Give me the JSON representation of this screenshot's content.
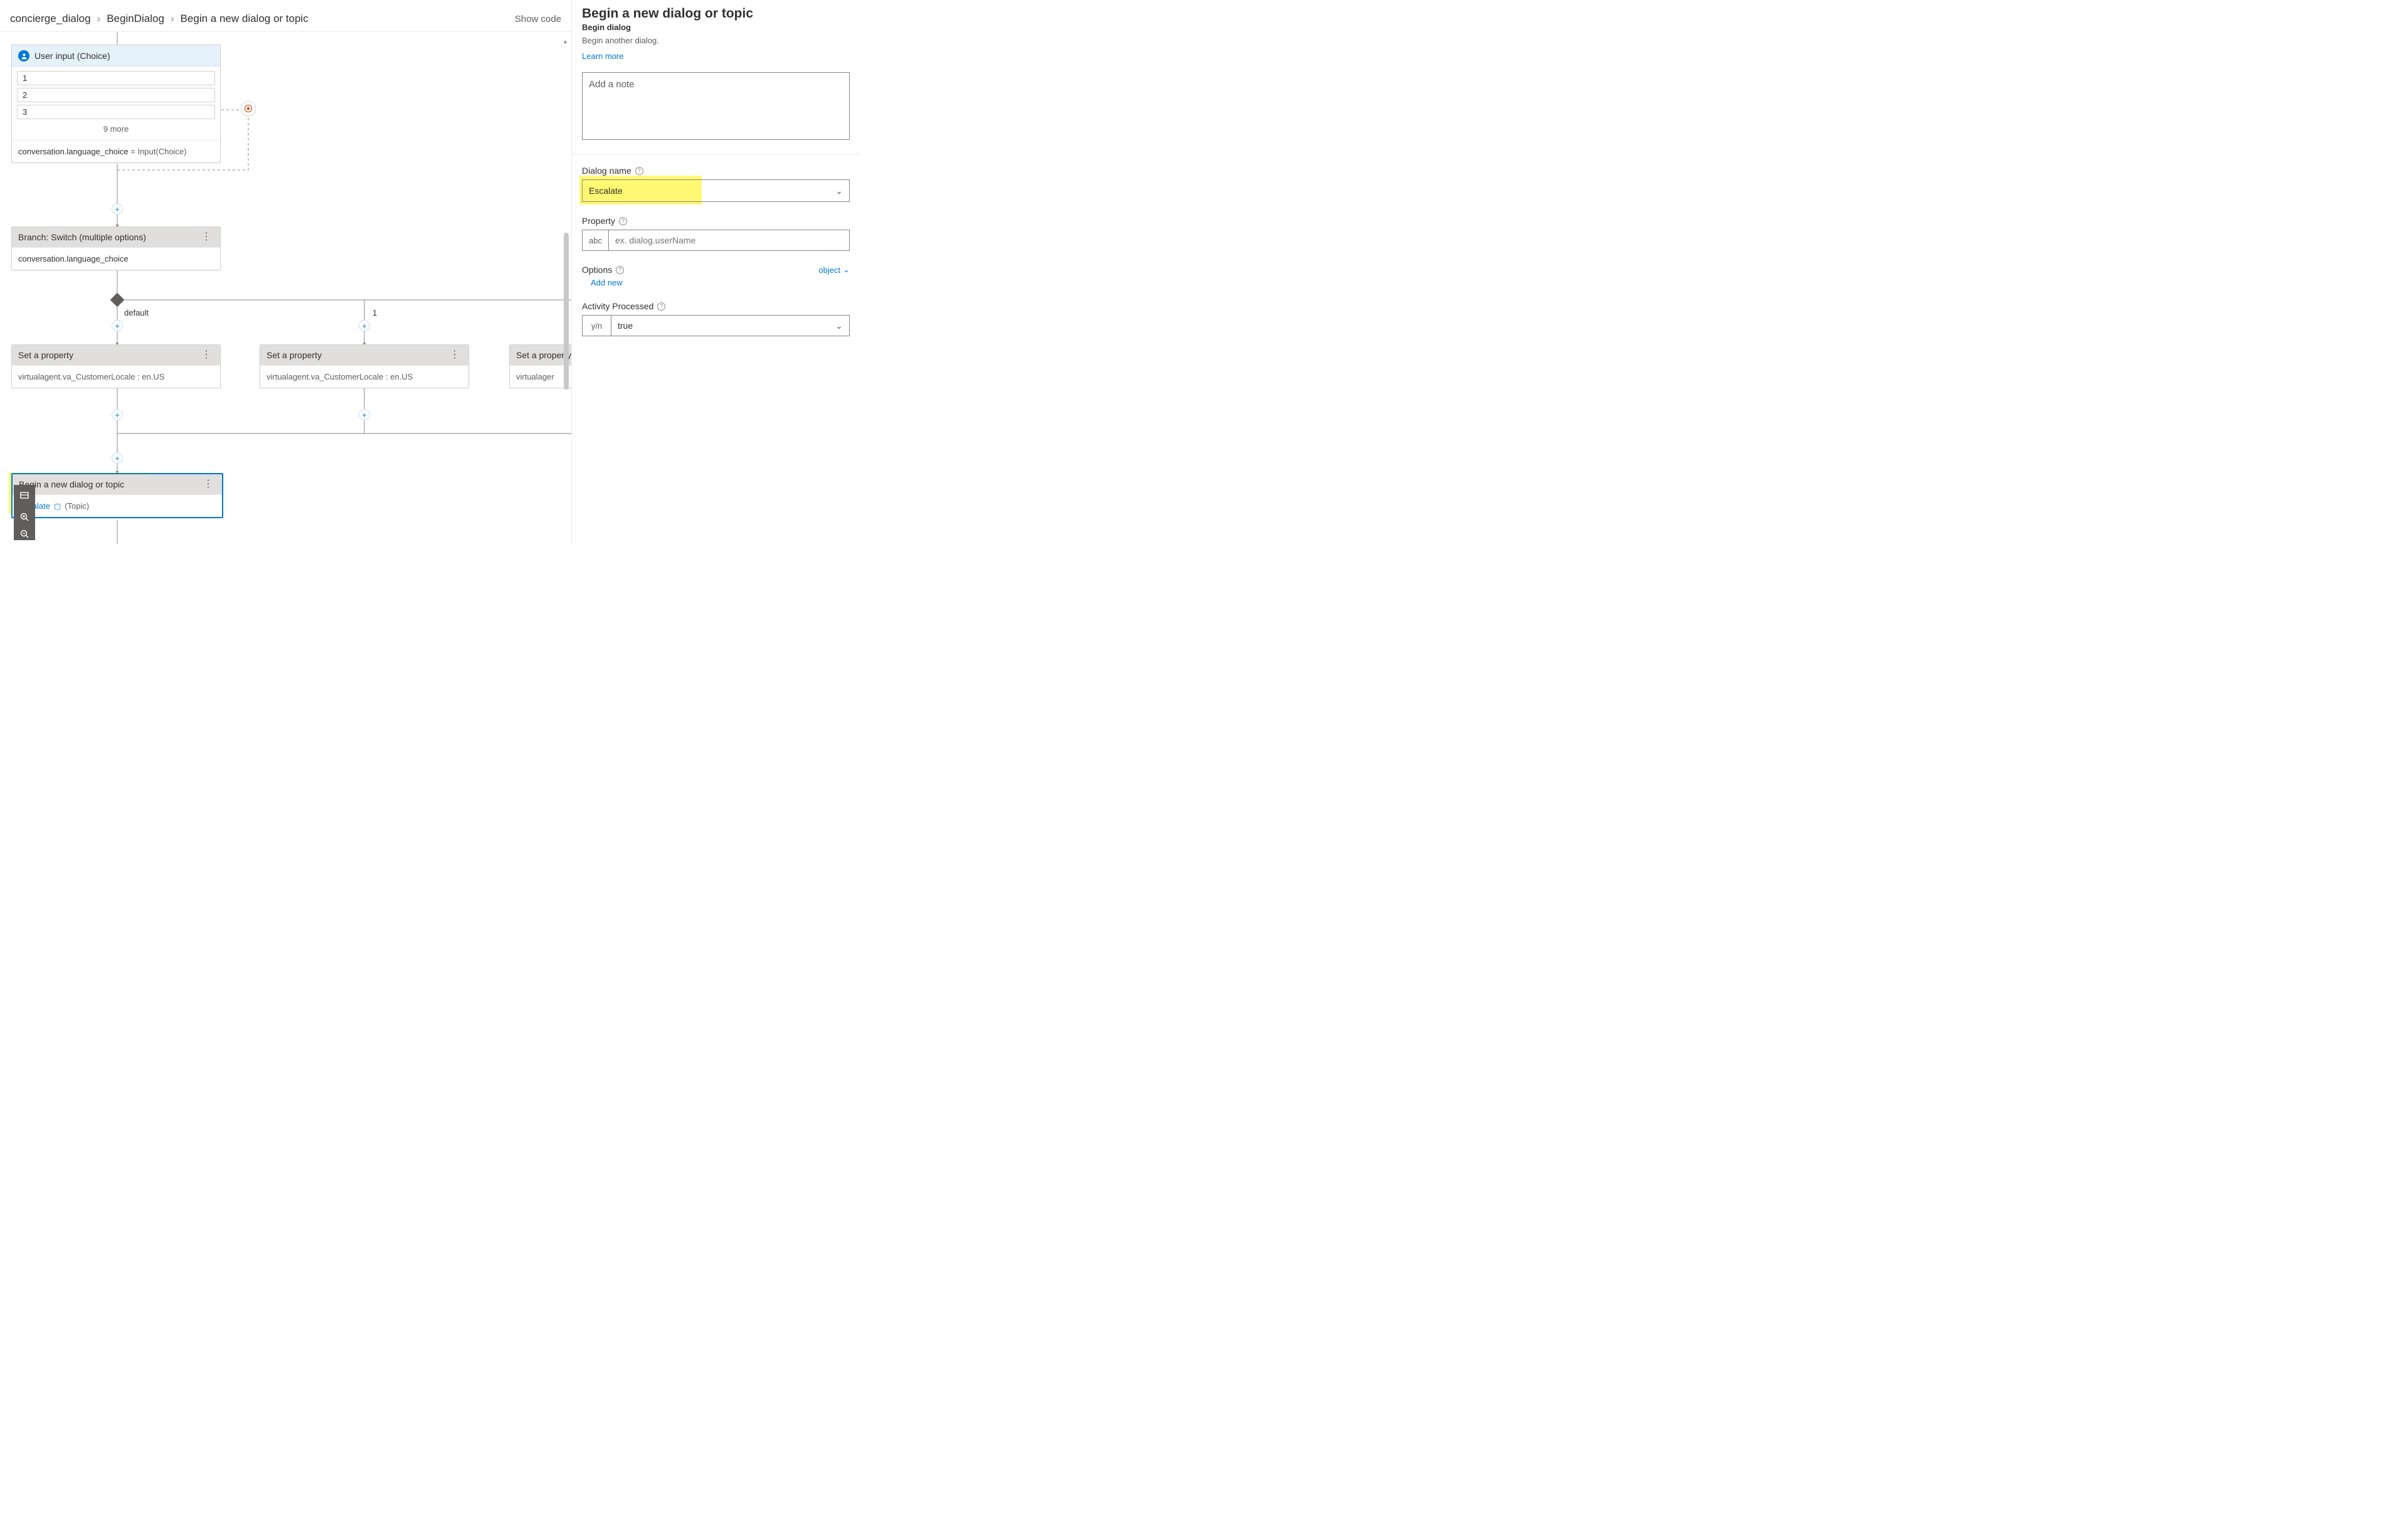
{
  "breadcrumb": {
    "items": [
      "concierge_dialog",
      "BeginDialog",
      "Begin a new dialog or topic"
    ],
    "show_code": "Show code"
  },
  "canvas": {
    "user_input": {
      "title": "User input (Choice)",
      "items": [
        "1",
        "2",
        "3"
      ],
      "more": "9 more",
      "footer_var": "conversation.language_choice",
      "footer_eq": " = Input(Choice)"
    },
    "switch": {
      "title": "Branch: Switch (multiple options)",
      "expression": "conversation.language_choice"
    },
    "branches": {
      "default_label": "default",
      "one_label": "1"
    },
    "setprop": {
      "title": "Set a property",
      "body_a": "virtualagent.va_CustomerLocale : en.US",
      "body_b": "virtualagent.va_CustomerLocale : en.US",
      "body_c": "virtualager"
    },
    "begindialog": {
      "title": "Begin a new dialog or topic",
      "link": "Escalate",
      "suffix": "(Topic)"
    }
  },
  "panel": {
    "title": "Begin a new dialog or topic",
    "subtitle": "Begin dialog",
    "description": "Begin another dialog.",
    "learn_more": "Learn more",
    "note_placeholder": "Add a note",
    "dialog_name_label": "Dialog name",
    "dialog_name_value": "Escalate",
    "property_label": "Property",
    "property_prefix": "abc",
    "property_placeholder": "ex. dialog.userName",
    "options_label": "Options",
    "options_type": "object",
    "add_new": "Add new",
    "activity_label": "Activity Processed",
    "activity_prefix": "y/n",
    "activity_value": "true"
  }
}
